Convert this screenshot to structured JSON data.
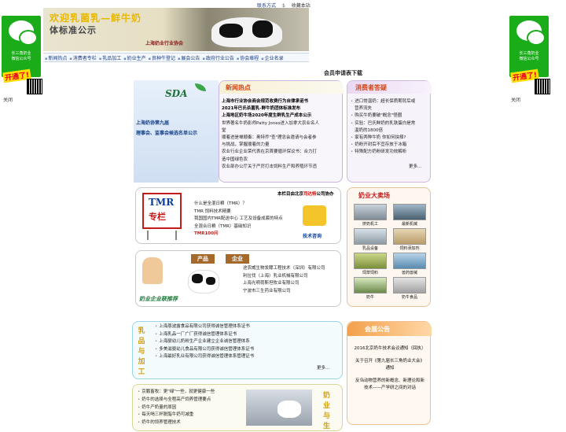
{
  "side_ads": {
    "left": {
      "text": "长三角奶业\n微信公众号",
      "tag": "开通了!",
      "close": "关闭"
    },
    "right": {
      "text": "长三角奶业\n微信公众号",
      "tag": "开通了!",
      "close": "关闭"
    }
  },
  "header": {
    "banner_line1": "欢迎乳菌乳—鲜牛奶",
    "banner_line2": "体标准公示",
    "org": "上海奶业行业协会",
    "top_links": [
      "联系方式",
      "$",
      "收藏本站"
    ]
  },
  "nav": {
    "items": [
      "新闻热点",
      "消费者专栏",
      "乳品加工",
      "奶业生产",
      "良种牛登记",
      "展会公告",
      "政府行业公告",
      "协会章程",
      "企业名录"
    ]
  },
  "register_link": "会员申请表下载",
  "left_promo": {
    "logo": "SDA",
    "lines": [
      "上海奶协第九届",
      "理事会、监事会候选名单公示"
    ]
  },
  "news": {
    "title": "新闻热点",
    "items": [
      {
        "text": "上海市行业协会商会规范收费行为自律承诺书",
        "bold": true
      },
      {
        "text": "2021年巴氏杀菌乳-鲜牛奶团体标准发布",
        "bold": true
      },
      {
        "text": "上海地区奶牛场2020年度生鲜乳生产成本公示",
        "bold": true
      },
      {
        "text": "世界著名牛奶影师Patty Jones进入加拿大农业名人",
        "bold": false
      },
      {
        "text": "堂",
        "bold": false
      },
      {
        "text": "顺着进是禅顺奏：奥特乔\"查\"理念会邀请与会者参",
        "bold": false
      },
      {
        "text": "与挑战，掌握顺着的力量",
        "bold": false
      },
      {
        "text": "农业行业企业荣代表在京首要循环保议书：合力打",
        "bold": false
      },
      {
        "text": "造中国绿色农",
        "bold": false
      },
      {
        "text": "农业部办公厅关于严厉打击饲料生产和养殖环节违",
        "bold": false
      }
    ]
  },
  "consumer": {
    "title": "消费者答疑",
    "items": [
      "进口常温奶：超长保质期背后或",
      "营养流失",
      "购买牛奶要破\"概念\"怪圈",
      "实验：巴氏鲜奶的乳铁蛋白是常",
      "温奶的1800倍",
      "家有两种牛奶 你如何抉择?",
      "奶粉开封后不宜存放于冰箱",
      "特殊配方奶粉研发功效解析"
    ],
    "more": "更多..."
  },
  "tmr": {
    "sign_line1": "TMR",
    "sign_line2": "专栏",
    "header_prefix": "本栏目由北京",
    "header_highlight": "司达特",
    "header_suffix": "公司协办",
    "items": [
      "什么是全混日粮（TMR）？",
      "TMR 饲料技术精要",
      "我国国内TMR配送中心 工艺及设备成套的特点",
      "全混合日粮（TMR）基础知识",
      "TMR100问"
    ],
    "tech_consult": "技术咨询"
  },
  "market": {
    "title": "奶业大卖场",
    "items": [
      "挤奶机工",
      "最新机械",
      "乳品设备",
      "饲料添加剂",
      "饲草饲料",
      "兽药兽械",
      "奶牛",
      "奶牛食品"
    ]
  },
  "enterprise": {
    "tabs": [
      "产品",
      "企业"
    ],
    "left_label": "奶业企业联推荐",
    "items": [
      "途农威生物发酵工程技术（深圳）有限公司",
      "利拉伐（上海）乳业机械有限公司",
      "上海光明荷斯坦牧业有限公司",
      "宁波市三生药业有限公司"
    ]
  },
  "processing": {
    "label": "乳品与加工",
    "items": [
      "上海恩波露食品有限公司获得诚信管理体系证书",
      "上海乳品一厂广厂获得诚信管理体系证书",
      "上海婴幼儿奶粉生产企业建立企业诚信管理体系",
      "多美滋婴幼儿食品有限公司获得诚信管理体系证书",
      "上海最好乳业有限公司获得诚信管理体系管理证书"
    ],
    "more": "更多..."
  },
  "congress": {
    "title": "会展公告",
    "items": [
      "2016北京奶牛技术会议通知（回执）",
      "关于召开《第九届长三角奶业大会》通知",
      "反刍动物营养的新概念、新理论和新技术——产学研之间的对话"
    ]
  },
  "bottom": {
    "label": "奶业与生",
    "items": [
      "京鹏畜牧：更\"绿\"一些，就更健康一些",
      "奶牛的选择与全程高产饲养管理要点",
      "奶牛产奶量的原因",
      "每天喝三杯脱脂牛奶可减重",
      "奶牛的饲养管理技术"
    ]
  }
}
